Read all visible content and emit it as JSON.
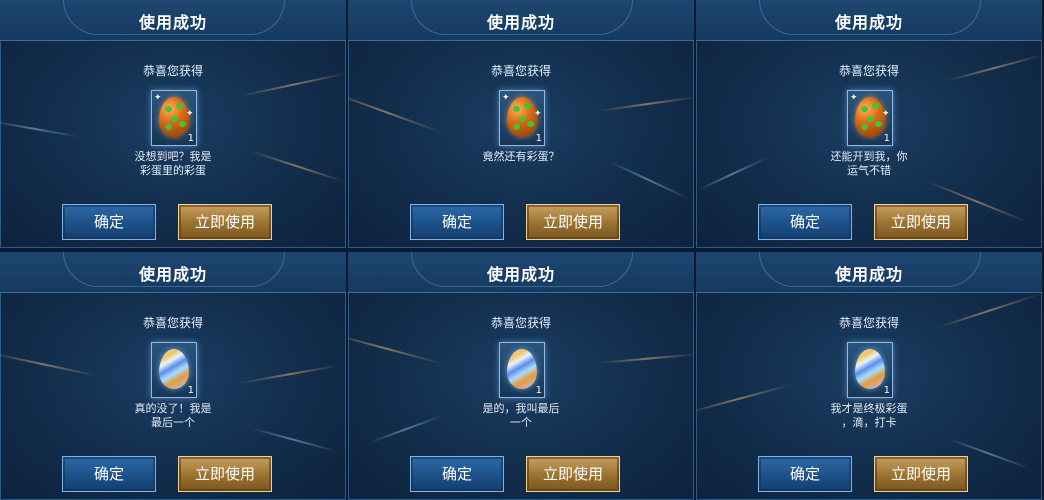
{
  "panels": [
    {
      "title": "使用成功",
      "subtitle": "恭喜您获得",
      "item": {
        "icon": "spotted-egg-icon",
        "count": "1"
      },
      "message": "没想到吧？我是\n彩蛋里的彩蛋",
      "confirm_label": "确定",
      "use_label": "立即使用"
    },
    {
      "title": "使用成功",
      "subtitle": "恭喜您获得",
      "item": {
        "icon": "spotted-egg-icon",
        "count": "1"
      },
      "message": "竟然还有彩蛋？",
      "confirm_label": "确定",
      "use_label": "立即使用"
    },
    {
      "title": "使用成功",
      "subtitle": "恭喜您获得",
      "item": {
        "icon": "spotted-egg-icon",
        "count": "1"
      },
      "message": "还能开到我，你\n运气不错",
      "confirm_label": "确定",
      "use_label": "立即使用"
    },
    {
      "title": "使用成功",
      "subtitle": "恭喜您获得",
      "item": {
        "icon": "striped-egg-icon",
        "count": "1"
      },
      "message": "真的没了！我是\n最后一个",
      "confirm_label": "确定",
      "use_label": "立即使用"
    },
    {
      "title": "使用成功",
      "subtitle": "恭喜您获得",
      "item": {
        "icon": "striped-egg-icon",
        "count": "1"
      },
      "message": "是的，我叫最后\n一个",
      "confirm_label": "确定",
      "use_label": "立即使用"
    },
    {
      "title": "使用成功",
      "subtitle": "恭喜您获得",
      "item": {
        "icon": "striped-egg-icon",
        "count": "1"
      },
      "message": "我才是终极彩蛋\n，滴，打卡",
      "confirm_label": "确定",
      "use_label": "立即使用"
    }
  ],
  "colors": {
    "background": "#13304f",
    "confirm_button": "#1b4f86",
    "use_button": "#9a7230",
    "text": "#ffffff"
  }
}
